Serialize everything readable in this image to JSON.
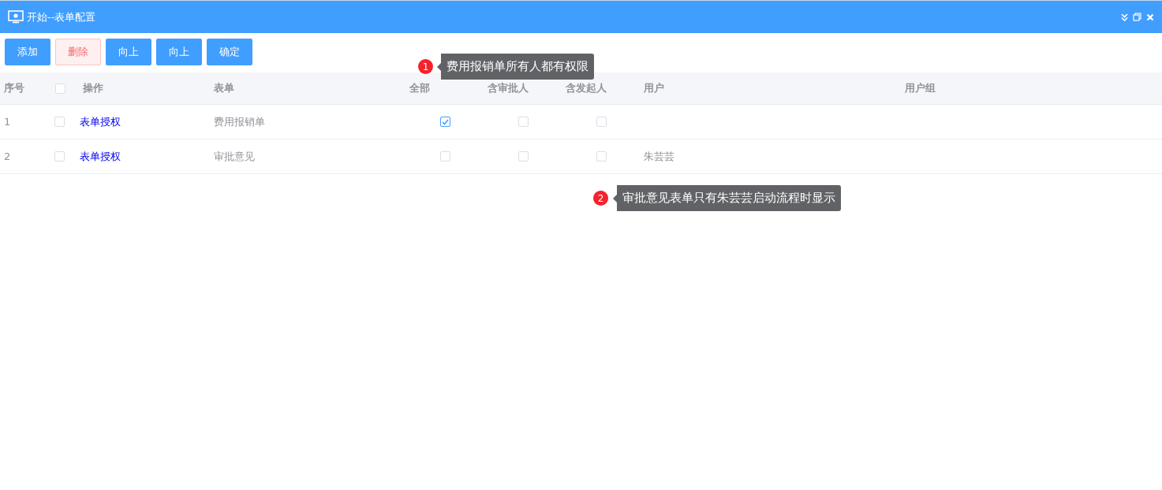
{
  "window": {
    "title": "开始--表单配置"
  },
  "toolbar": [
    {
      "label": "添加",
      "kind": "primary"
    },
    {
      "label": "删除",
      "kind": "danger"
    },
    {
      "label": "向上",
      "kind": "primary"
    },
    {
      "label": "向上",
      "kind": "primary"
    },
    {
      "label": "确定",
      "kind": "primary"
    }
  ],
  "table": {
    "columns": [
      "序号",
      "操作",
      "表单",
      "全部",
      "含审批人",
      "含发起人",
      "用户",
      "用户组"
    ],
    "select_all_checked": false,
    "rows": [
      {
        "index": "1",
        "selected": false,
        "action": "表单授权",
        "form": "费用报销单",
        "all": true,
        "approver": false,
        "initiator": false,
        "user": ""
      },
      {
        "index": "2",
        "selected": false,
        "action": "表单授权",
        "form": "审批意见",
        "all": false,
        "approver": false,
        "initiator": false,
        "user": "朱芸芸"
      }
    ]
  },
  "annotations": [
    {
      "number": "1",
      "text": "费用报销单所有人都有权限"
    },
    {
      "number": "2",
      "text": "审批意见表单只有朱芸芸启动流程时显示"
    }
  ]
}
